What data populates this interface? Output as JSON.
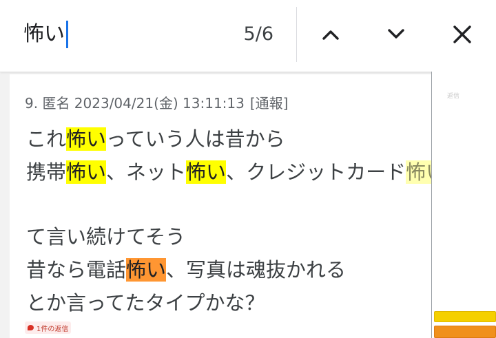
{
  "find_bar": {
    "query": "怖い",
    "match_count": "5/6",
    "icons": {
      "up": "chevron-up-icon",
      "down": "chevron-down-icon",
      "close": "close-icon"
    }
  },
  "post": {
    "header": "9. 匿名 2023/04/21(金) 13:11:13",
    "report": "[通報]",
    "lines": [
      [
        "これ",
        "怖い",
        "っていう人は昔から"
      ],
      [
        "携帯",
        "怖い",
        "、ネット",
        "怖い",
        "、クレジットカード",
        "怖い"
      ],
      [
        "て言い続けてそう"
      ],
      [
        "昔なら電話",
        "怖い",
        "、写真は魂抜かれる"
      ],
      [
        "とか言ってたタイプかな？"
      ]
    ],
    "reply_badge": "1件の返信"
  },
  "gutter": {
    "reply_label": "返信"
  },
  "colors": {
    "highlight": "#ffff00",
    "active_highlight": "#ff9632",
    "caret": "#1a73e8"
  }
}
